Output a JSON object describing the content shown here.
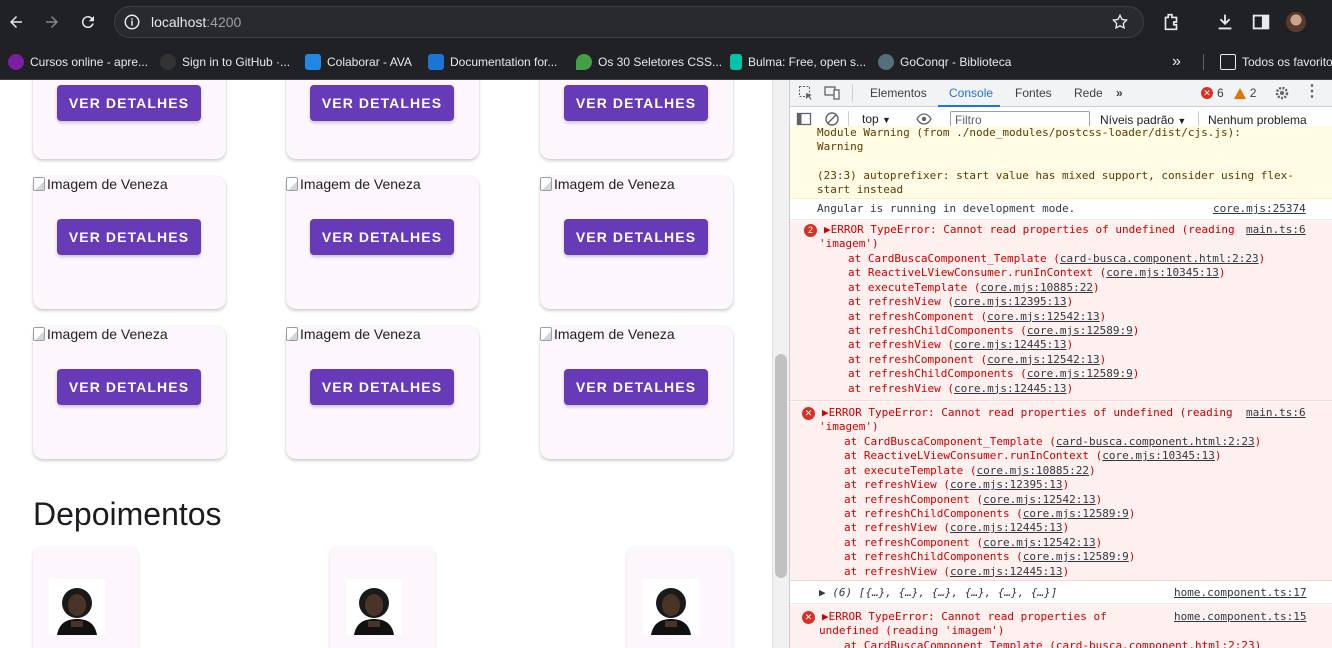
{
  "browser": {
    "url_host": "localhost",
    "url_port": ":4200",
    "bookmarks": [
      {
        "label": "Cursos online - apre...",
        "color": "#7b1fa2"
      },
      {
        "label": "Sign in to GitHub ·...",
        "color": "#333333"
      },
      {
        "label": "Colaborar - AVA",
        "color": "#1e88e5"
      },
      {
        "label": "Documentation for...",
        "color": "#1976d2"
      },
      {
        "label": "Os 30 Seletores CSS...",
        "color": "#43a047"
      },
      {
        "label": "Bulma: Free, open s...",
        "color": "#00c4a7"
      },
      {
        "label": "GoConqr - Biblioteca",
        "color": "#546e7a"
      }
    ],
    "all_favorites": "Todos os favoritos"
  },
  "page": {
    "card_image_alt": "Imagem de Veneza",
    "card_button_label": "VER DETALHES",
    "testimonials_title": "Depoimentos"
  },
  "devtools": {
    "tabs": [
      "Elementos",
      "Console",
      "Fontes",
      "Rede"
    ],
    "active_tab": "Console",
    "error_count": "6",
    "warning_count": "2",
    "context": "top",
    "filter_placeholder": "Filtro",
    "levels": "Níveis padrão",
    "issues": "Nenhum problema",
    "warning_msg": {
      "line1": "Module Warning (from ./node_modules/postcss-loader/dist/cjs.js):",
      "line2": "Warning",
      "line3": "(23:3) autoprefixer: start value has mixed support, consider using flex-",
      "line4": "start instead"
    },
    "info_msg": {
      "text": "Angular is running in development mode.",
      "source": "core.mjs:25374"
    },
    "error1": {
      "repeat": "2",
      "head": "▶ERROR TypeError: Cannot read properties of undefined (reading",
      "head2": "'imagem')",
      "source": "main.ts:6",
      "stack": [
        {
          "fn": "at CardBuscaComponent_Template (",
          "loc": "card-busca.component.html:2:23",
          "end": ")"
        },
        {
          "fn": "at ReactiveLViewConsumer.runInContext (",
          "loc": "core.mjs:10345:13",
          "end": ")"
        },
        {
          "fn": "at executeTemplate (",
          "loc": "core.mjs:10885:22",
          "end": ")"
        },
        {
          "fn": "at refreshView (",
          "loc": "core.mjs:12395:13",
          "end": ")"
        },
        {
          "fn": "at refreshComponent (",
          "loc": "core.mjs:12542:13",
          "end": ")"
        },
        {
          "fn": "at refreshChildComponents (",
          "loc": "core.mjs:12589:9",
          "end": ")"
        },
        {
          "fn": "at refreshView (",
          "loc": "core.mjs:12445:13",
          "end": ")"
        },
        {
          "fn": "at refreshComponent (",
          "loc": "core.mjs:12542:13",
          "end": ")"
        },
        {
          "fn": "at refreshChildComponents (",
          "loc": "core.mjs:12589:9",
          "end": ")"
        },
        {
          "fn": "at refreshView (",
          "loc": "core.mjs:12445:13",
          "end": ")"
        }
      ]
    },
    "error2": {
      "head": "▶ERROR TypeError: Cannot read properties of undefined (reading",
      "head2": "'imagem')",
      "source": "main.ts:6",
      "stack": [
        {
          "fn": "at CardBuscaComponent_Template (",
          "loc": "card-busca.component.html:2:23",
          "end": ")"
        },
        {
          "fn": "at ReactiveLViewConsumer.runInContext (",
          "loc": "core.mjs:10345:13",
          "end": ")"
        },
        {
          "fn": "at executeTemplate (",
          "loc": "core.mjs:10885:22",
          "end": ")"
        },
        {
          "fn": "at refreshView (",
          "loc": "core.mjs:12395:13",
          "end": ")"
        },
        {
          "fn": "at refreshComponent (",
          "loc": "core.mjs:12542:13",
          "end": ")"
        },
        {
          "fn": "at refreshChildComponents (",
          "loc": "core.mjs:12589:9",
          "end": ")"
        },
        {
          "fn": "at refreshView (",
          "loc": "core.mjs:12445:13",
          "end": ")"
        },
        {
          "fn": "at refreshComponent (",
          "loc": "core.mjs:12542:13",
          "end": ")"
        },
        {
          "fn": "at refreshChildComponents (",
          "loc": "core.mjs:12589:9",
          "end": ")"
        },
        {
          "fn": "at refreshView (",
          "loc": "core.mjs:12445:13",
          "end": ")"
        }
      ]
    },
    "log_msg": {
      "text": "▶ (6) [{…}, {…}, {…}, {…}, {…}, {…}]",
      "source": "home.component.ts:17"
    },
    "error3": {
      "head": "▶ERROR TypeError: Cannot read properties of",
      "head2": "undefined (reading 'imagem')",
      "source": "home.component.ts:15",
      "stack_partial": "at CardBuscaComponent_Template (card-busca.component.html:2:23)"
    }
  }
}
